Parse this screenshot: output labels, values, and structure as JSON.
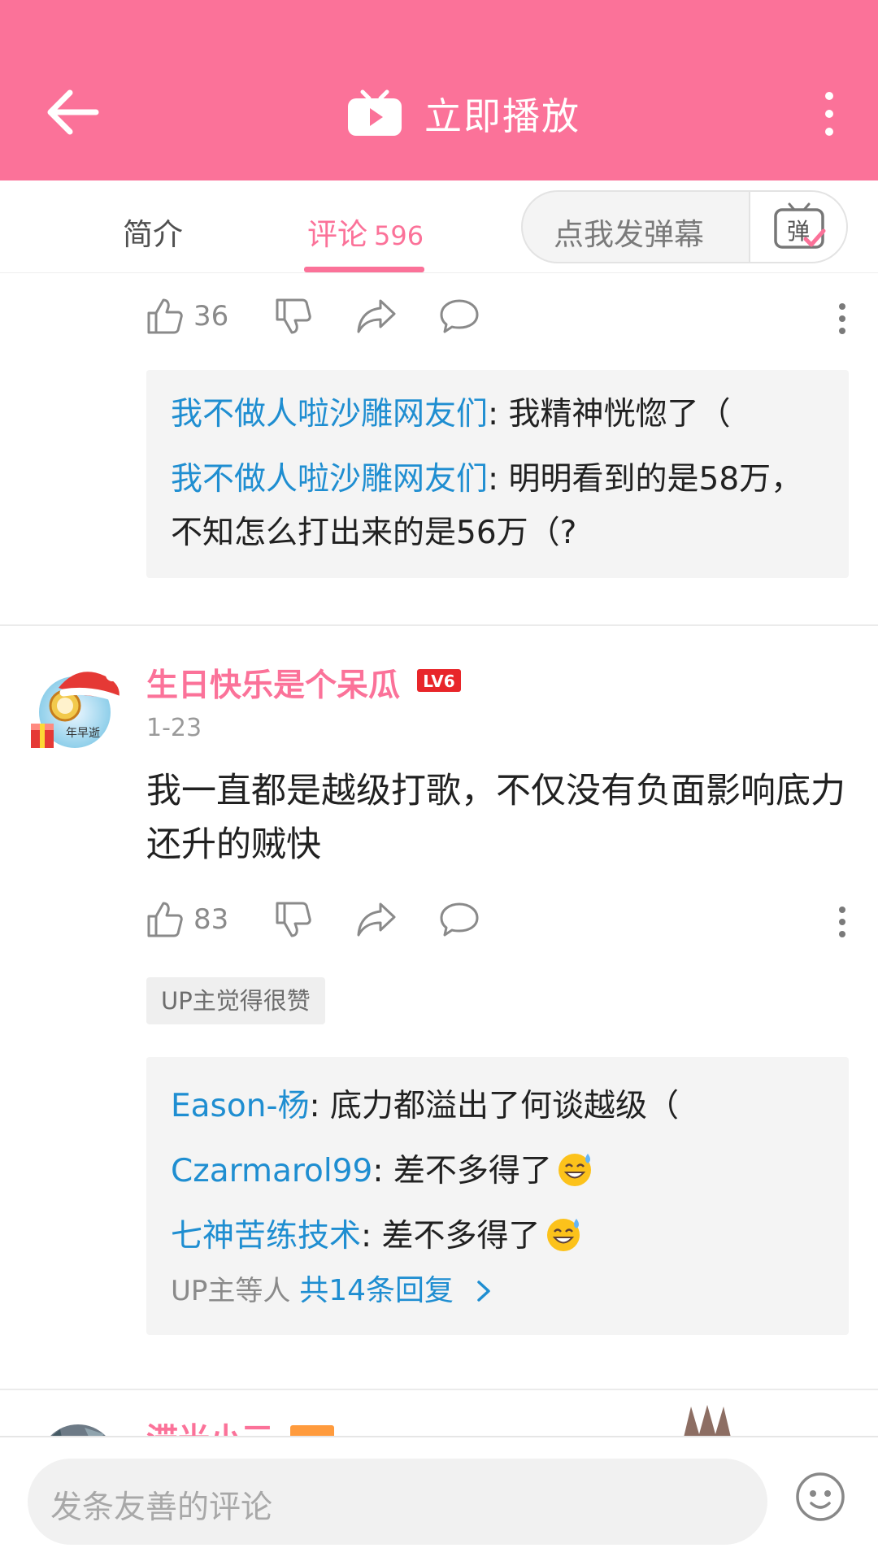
{
  "header": {
    "play_label": "立即播放",
    "back_icon": "back-arrow-icon",
    "play_icon": "tv-play-icon",
    "more_icon": "more-vertical-icon"
  },
  "tabs": {
    "intro": "简介",
    "comments": "评论",
    "comments_count": "596"
  },
  "danmaku": {
    "label": "点我发弹幕",
    "icon_text": "弹"
  },
  "comment1": {
    "likes": "36",
    "replies": [
      {
        "name": "我不做人啦沙雕网友们",
        "text": ": 我精神恍惚了（"
      },
      {
        "name": "我不做人啦沙雕网友们",
        "text": ": 明明看到的是58万，不知怎么打出来的是56万（?"
      }
    ]
  },
  "comment2": {
    "username": "生日快乐是个呆瓜",
    "level": "LV6",
    "avatar_text": "年早逝",
    "date": "1-23",
    "text": "我一直都是越级打歌，不仅没有负面影响底力还升的贼快",
    "likes": "83",
    "up_tag": "UP主觉得很赞",
    "replies": [
      {
        "name": "Eason-杨",
        "text": ": 底力都溢出了何谈越级（"
      },
      {
        "name": "Czarmarol99",
        "text": ": 差不多得了",
        "emoji": "sweat-smile"
      },
      {
        "name": "七神苦练技术",
        "text": ": 差不多得了",
        "emoji": "sweat-smile"
      }
    ],
    "more_prefix": "UP主等人 ",
    "more_link": "共14条回复"
  },
  "comment3": {
    "username": "滞光小三"
  },
  "bottom": {
    "placeholder": "发条友善的评论",
    "emoji_icon": "emoji-face-icon"
  },
  "colors": {
    "brand": "#fb7299",
    "link": "#1f8ed1"
  }
}
